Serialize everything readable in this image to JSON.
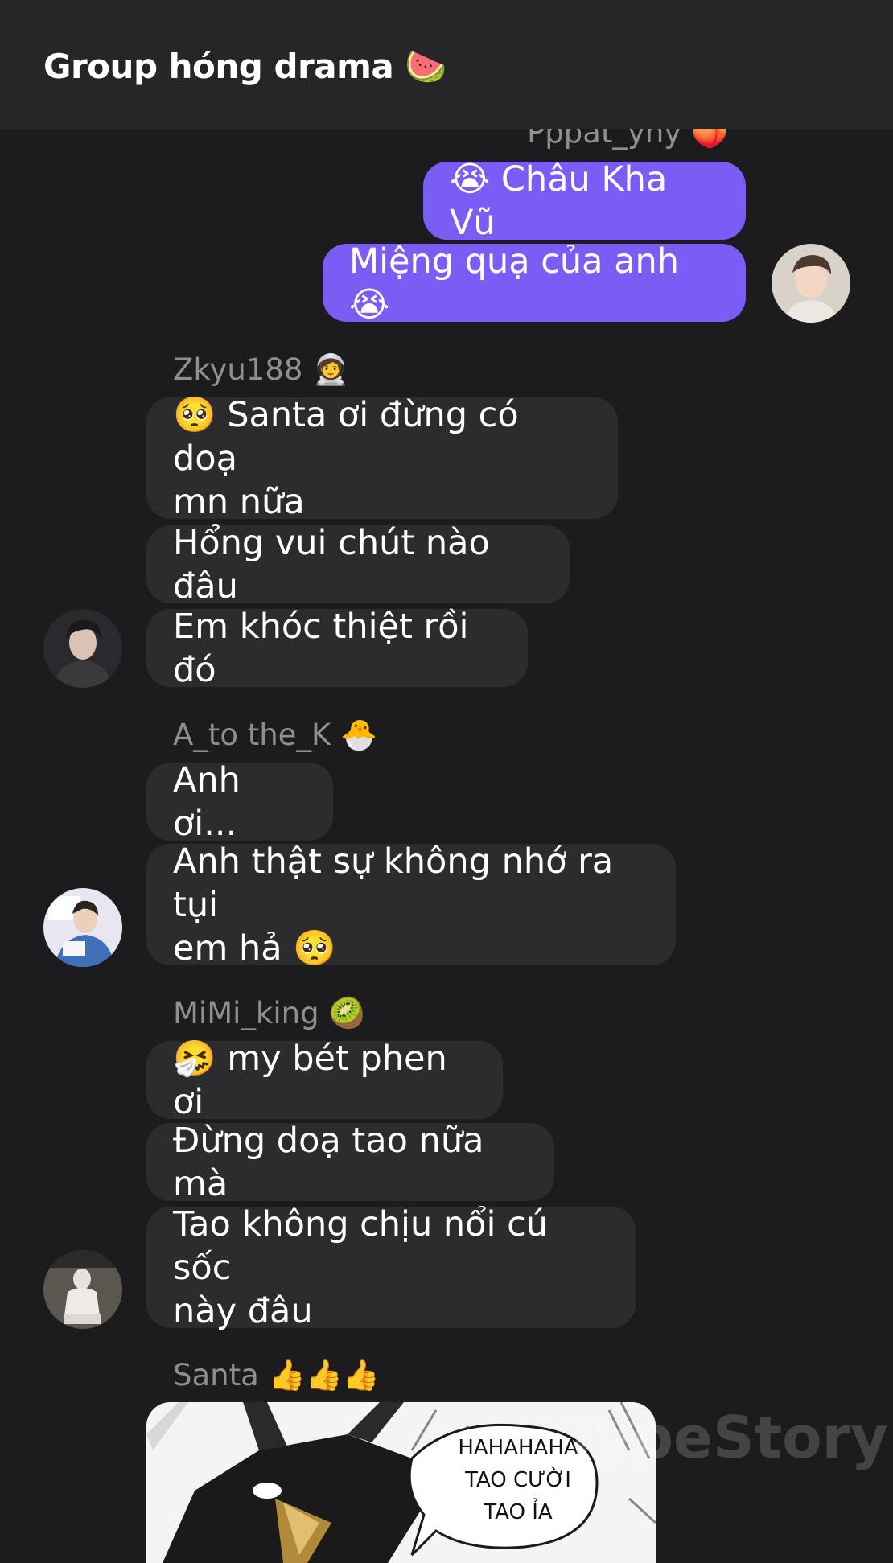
{
  "header": {
    "title": "Group hóng drama 🍉"
  },
  "messages": {
    "top_sender": "Pppat_yhy 🍑",
    "out1": "😭 Châu Kha Vũ",
    "out2": "Miệng quạ của anh 😭",
    "g1_sender": "Zkyu188 🧑‍🚀",
    "g1_m1_line1": "🥺 Santa ơi đừng có doạ",
    "g1_m1_line2": "mn nữa",
    "g1_m2": "Hổng vui chút nào đâu",
    "g1_m3": "Em khóc thiệt rồi đó",
    "g2_sender": "A_to the_K 🐣",
    "g2_m1": "Anh ơi...",
    "g2_m2_line1": "Anh thật sự không nhớ ra tụi",
    "g2_m2_line2": "em hả 🥺",
    "g3_sender": "MiMi_king 🥝",
    "g3_m1": "🤧 my bét phen ơi",
    "g3_m2": "Đừng doạ tao nữa mà",
    "g3_m3_line1": "Tao không chịu nổi cú sốc",
    "g3_m3_line2": "này đâu",
    "g4_sender": "Santa 👍👍👍",
    "image_text_line1": "HAHAHAHA",
    "image_text_line2": "TAO CƯỜI",
    "image_text_line3": "TAO ỈA"
  },
  "watermark": "TypeStory",
  "colors": {
    "background": "#1c1c1e",
    "header": "#262628",
    "incoming_bubble": "#2c2c2e",
    "outgoing_bubble": "#7b5cf5",
    "sender_name": "#8e8e93"
  }
}
